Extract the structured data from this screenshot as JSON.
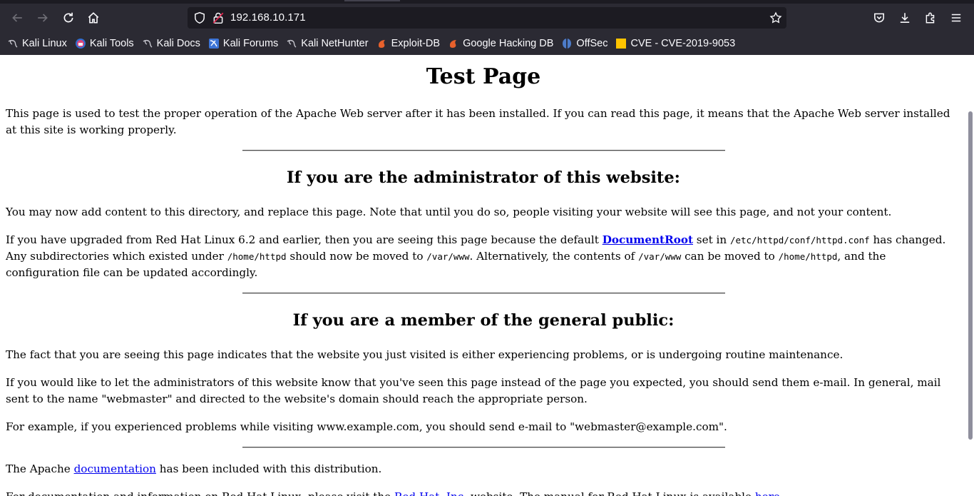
{
  "browser": {
    "url": "192.168.10.171",
    "bookmarks": [
      {
        "label": "Kali Linux",
        "icon": "kali-dragon-icon"
      },
      {
        "label": "Kali Tools",
        "icon": "kali-tools-icon"
      },
      {
        "label": "Kali Docs",
        "icon": "kali-dragon-icon"
      },
      {
        "label": "Kali Forums",
        "icon": "kali-forums-icon"
      },
      {
        "label": "Kali NetHunter",
        "icon": "kali-dragon-icon"
      },
      {
        "label": "Exploit-DB",
        "icon": "exploit-db-icon"
      },
      {
        "label": "Google Hacking DB",
        "icon": "exploit-db-icon"
      },
      {
        "label": "OffSec",
        "icon": "offsec-icon"
      },
      {
        "label": "CVE - CVE-2019-9053",
        "icon": "cve-icon"
      }
    ]
  },
  "page": {
    "title": "Test Page",
    "intro": "This page is used to test the proper operation of the Apache Web server after it has been installed. If you can read this page, it means that the Apache Web server installed at this site is working properly.",
    "admin_heading": "If you are the administrator of this website:",
    "admin_p1": "You may now add content to this directory, and replace this page. Note that until you do so, people visiting your website will see this page, and not your content.",
    "admin_p2": {
      "t1": "If you have upgraded from Red Hat Linux 6.2 and earlier, then you are seeing this page because the default ",
      "link": "DocumentRoot",
      "t2": " set in ",
      "code1": "/etc/httpd/conf/httpd.conf",
      "t3": " has changed. Any subdirectories which existed under ",
      "code2": "/home/httpd",
      "t4": " should now be moved to ",
      "code3": "/var/www",
      "t5": ". Alternatively, the contents of ",
      "code4": "/var/www",
      "t6": " can be moved to ",
      "code5": "/home/httpd",
      "t7": ", and the configuration file can be updated accordingly."
    },
    "public_heading": "If you are a member of the general public:",
    "public_p1": "The fact that you are seeing this page indicates that the website you just visited is either experiencing problems, or is undergoing routine maintenance.",
    "public_p2": "If you would like to let the administrators of this website know that you've seen this page instead of the page you expected, you should send them e-mail. In general, mail sent to the name \"webmaster\" and directed to the website's domain should reach the appropriate person.",
    "public_p3": "For example, if you experienced problems while visiting www.example.com, you should send e-mail to \"webmaster@example.com\".",
    "doc_p": {
      "t1": "The Apache ",
      "link": "documentation",
      "t2": " has been included with this distribution."
    },
    "rh_p": {
      "t1": "For documentation and information on Red Hat Linux, please visit the ",
      "link1": "Red Hat, Inc.",
      "t2": " website. The manual for Red Hat Linux is available ",
      "link2": "here",
      "t3": "."
    }
  }
}
